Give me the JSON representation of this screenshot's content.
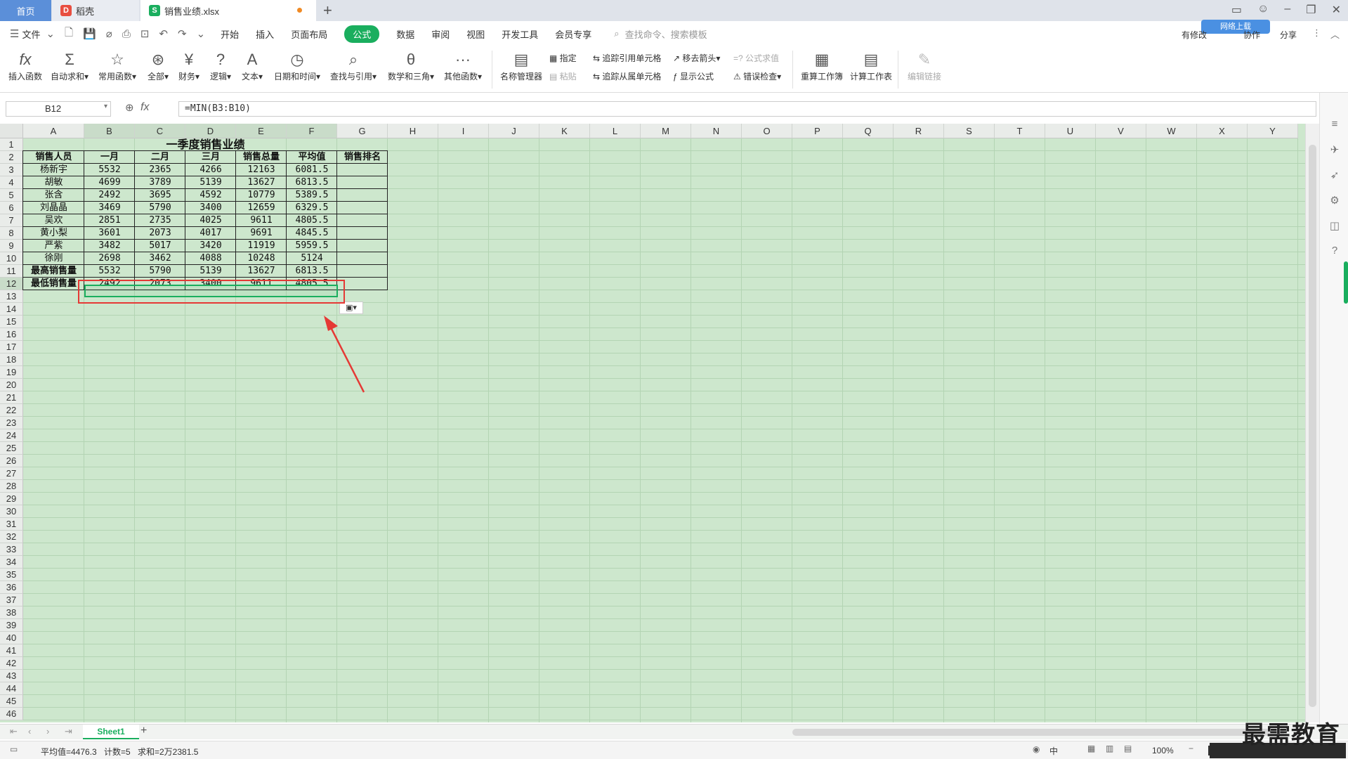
{
  "tabs": [
    {
      "label": "首页"
    },
    {
      "label": "稻壳"
    },
    {
      "label": "销售业绩.xlsx"
    }
  ],
  "menubar": {
    "file": "文件",
    "items": [
      "开始",
      "插入",
      "页面布局",
      "公式",
      "数据",
      "审阅",
      "视图",
      "开发工具",
      "会员专享"
    ],
    "active": "公式",
    "search_placeholder": "查找命令、搜索模板",
    "right": [
      "有修改",
      "协作",
      "分享"
    ],
    "badge": "网络上载"
  },
  "ribbon": {
    "insert_function": "插入函数",
    "autosum": "自动求和",
    "common": "常用函数",
    "all": "全部",
    "finance": "财务",
    "logic": "逻辑",
    "text": "文本",
    "datetime": "日期和时间",
    "lookup": "查找与引用",
    "math": "数学和三角",
    "other": "其他函数",
    "name_manager": "名称管理器",
    "specify": "指定",
    "paste": "粘贴",
    "trace_precedents": "追踪引用单元格",
    "trace_dependents": "追踪从属单元格",
    "remove_arrows": "移去箭头",
    "show_formulas": "显示公式",
    "eval_formula": "公式求值",
    "error_check": "错误检查",
    "recalc_book": "重算工作簿",
    "calc_sheet": "计算工作表",
    "edit_links": "编辑链接"
  },
  "formula_bar": {
    "name_box": "B12",
    "fx": "fx",
    "formula": "=MIN(B3:B10)"
  },
  "columns": [
    "A",
    "B",
    "C",
    "D",
    "E",
    "F",
    "G",
    "H",
    "I",
    "J",
    "K",
    "L",
    "M",
    "N",
    "O",
    "P",
    "Q",
    "R",
    "S",
    "T",
    "U",
    "V",
    "W",
    "X",
    "Y"
  ],
  "rows": [
    "1",
    "2",
    "3",
    "4",
    "5",
    "6",
    "7",
    "8",
    "9",
    "10",
    "11",
    "12",
    "13",
    "14",
    "15",
    "16",
    "17",
    "18",
    "19",
    "20",
    "21",
    "22",
    "23",
    "24",
    "25",
    "26",
    "27",
    "28",
    "29",
    "30",
    "31",
    "32",
    "33",
    "34",
    "35",
    "36",
    "37",
    "38",
    "39",
    "40",
    "41",
    "42",
    "43",
    "44",
    "45",
    "46"
  ],
  "sheet": {
    "title": "一季度销售业绩",
    "headers": [
      "销售人员",
      "一月",
      "二月",
      "三月",
      "销售总量",
      "平均值",
      "销售排名"
    ],
    "data": [
      [
        "杨新宇",
        "5532",
        "2365",
        "4266",
        "12163",
        "6081.5",
        ""
      ],
      [
        "胡敏",
        "4699",
        "3789",
        "5139",
        "13627",
        "6813.5",
        ""
      ],
      [
        "张含",
        "2492",
        "3695",
        "4592",
        "10779",
        "5389.5",
        ""
      ],
      [
        "刘晶晶",
        "3469",
        "5790",
        "3400",
        "12659",
        "6329.5",
        ""
      ],
      [
        "吴欢",
        "2851",
        "2735",
        "4025",
        "9611",
        "4805.5",
        ""
      ],
      [
        "黄小梨",
        "3601",
        "2073",
        "4017",
        "9691",
        "4845.5",
        ""
      ],
      [
        "严紫",
        "3482",
        "5017",
        "3420",
        "11919",
        "5959.5",
        ""
      ],
      [
        "徐刚",
        "2698",
        "3462",
        "4088",
        "10248",
        "5124",
        ""
      ],
      [
        "最高销售量",
        "5532",
        "5790",
        "5139",
        "13627",
        "6813.5",
        ""
      ],
      [
        "最低销售量",
        "2492",
        "2073",
        "3400",
        "9611",
        "4805.5",
        ""
      ]
    ]
  },
  "sheet_tabs": {
    "active": "Sheet1",
    "add": "+"
  },
  "status": {
    "average": "平均值=4476.3",
    "count": "计数=5",
    "sum": "求和=2万2381.5",
    "zoom": "100%",
    "ime": "中"
  },
  "watermark": "最需教育",
  "annotation": {
    "color": "#e53935"
  }
}
